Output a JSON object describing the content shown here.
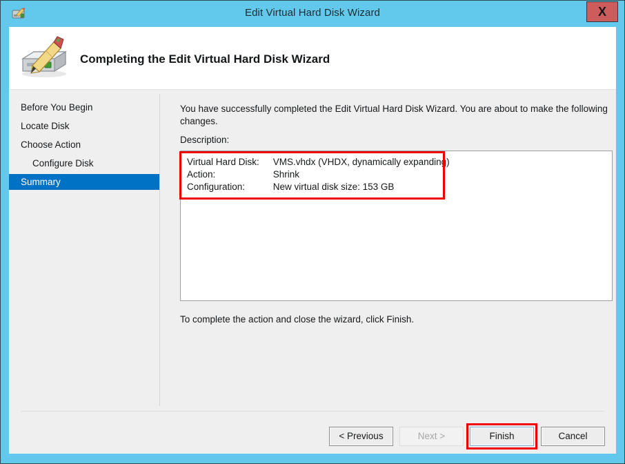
{
  "window": {
    "title": "Edit Virtual Hard Disk Wizard",
    "titlebar_icon": "vhd-edit-icon",
    "close_label": "X",
    "accent_color": "#62c9ec",
    "close_button_color": "#cd5c5c"
  },
  "header": {
    "icon": "hard-disk-with-pencil-icon",
    "title": "Completing the Edit Virtual Hard Disk Wizard"
  },
  "sidebar": {
    "selected_color": "#0072c6",
    "items": [
      {
        "label": "Before You Begin",
        "selected": false,
        "indented": false
      },
      {
        "label": "Locate Disk",
        "selected": false,
        "indented": false
      },
      {
        "label": "Choose Action",
        "selected": false,
        "indented": false
      },
      {
        "label": "Configure Disk",
        "selected": false,
        "indented": true
      },
      {
        "label": "Summary",
        "selected": true,
        "indented": false
      }
    ]
  },
  "main": {
    "intro_text": "You have successfully completed the Edit Virtual Hard Disk Wizard. You are about to make the following changes.",
    "description_label": "Description:",
    "description_rows": [
      {
        "key": "Virtual Hard Disk:",
        "value": "VMS.vhdx (VHDX, dynamically expanding)"
      },
      {
        "key": "Action:",
        "value": "Shrink"
      },
      {
        "key": "Configuration:",
        "value": "New virtual disk size: 153 GB"
      }
    ],
    "footer_note": "To complete the action and close the wizard, click Finish."
  },
  "buttons": {
    "previous": "< Previous",
    "next": "Next >",
    "finish": "Finish",
    "cancel": "Cancel"
  },
  "annotations": {
    "color": "#ee0000",
    "targets": [
      "description-rows",
      "finish-button"
    ]
  }
}
